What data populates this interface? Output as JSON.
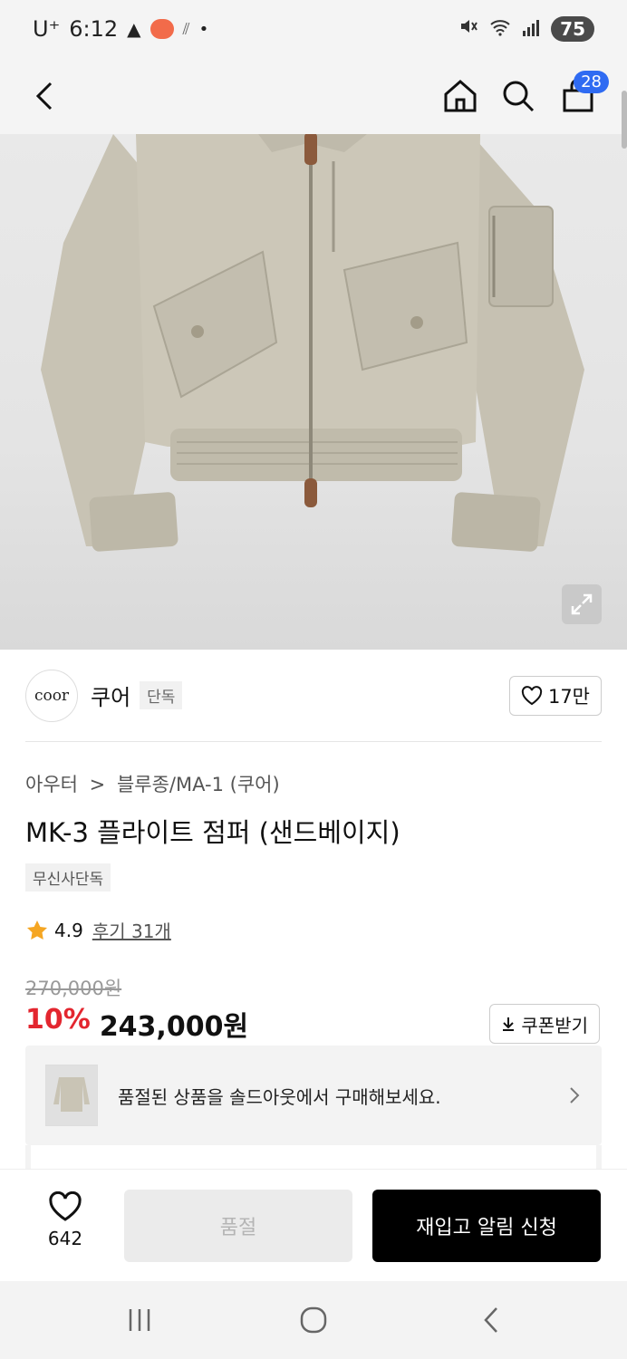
{
  "status_bar": {
    "carrier": "U⁺",
    "time": "6:12",
    "battery": "75"
  },
  "header": {
    "cart_count": "28"
  },
  "brand": {
    "logo_text": "coor",
    "name": "쿠어",
    "tag": "단독",
    "likes": "17만"
  },
  "product": {
    "breadcrumb_1": "아우터",
    "breadcrumb_sep": ">",
    "breadcrumb_2": "블루종/MA-1 (쿠어)",
    "title": "MK-3 플라이트 점퍼 (샌드베이지)",
    "exclusive_tag": "무신사단독",
    "rating": "4.9",
    "reviews": "후기 31개",
    "original_price": "270,000원",
    "discount": "10%",
    "price": "243,000원",
    "coupon_label": "쿠폰받기"
  },
  "soldout_banner": {
    "text": "품절된 상품을 솔드아웃에서 구매해보세요."
  },
  "bottom_bar": {
    "wish_count": "642",
    "soldout_label": "품절",
    "restock_label": "재입고 알림 신청"
  },
  "colors": {
    "discount": "#e3262f",
    "cart_badge": "#2f6bf2",
    "star": "#f5a623"
  }
}
